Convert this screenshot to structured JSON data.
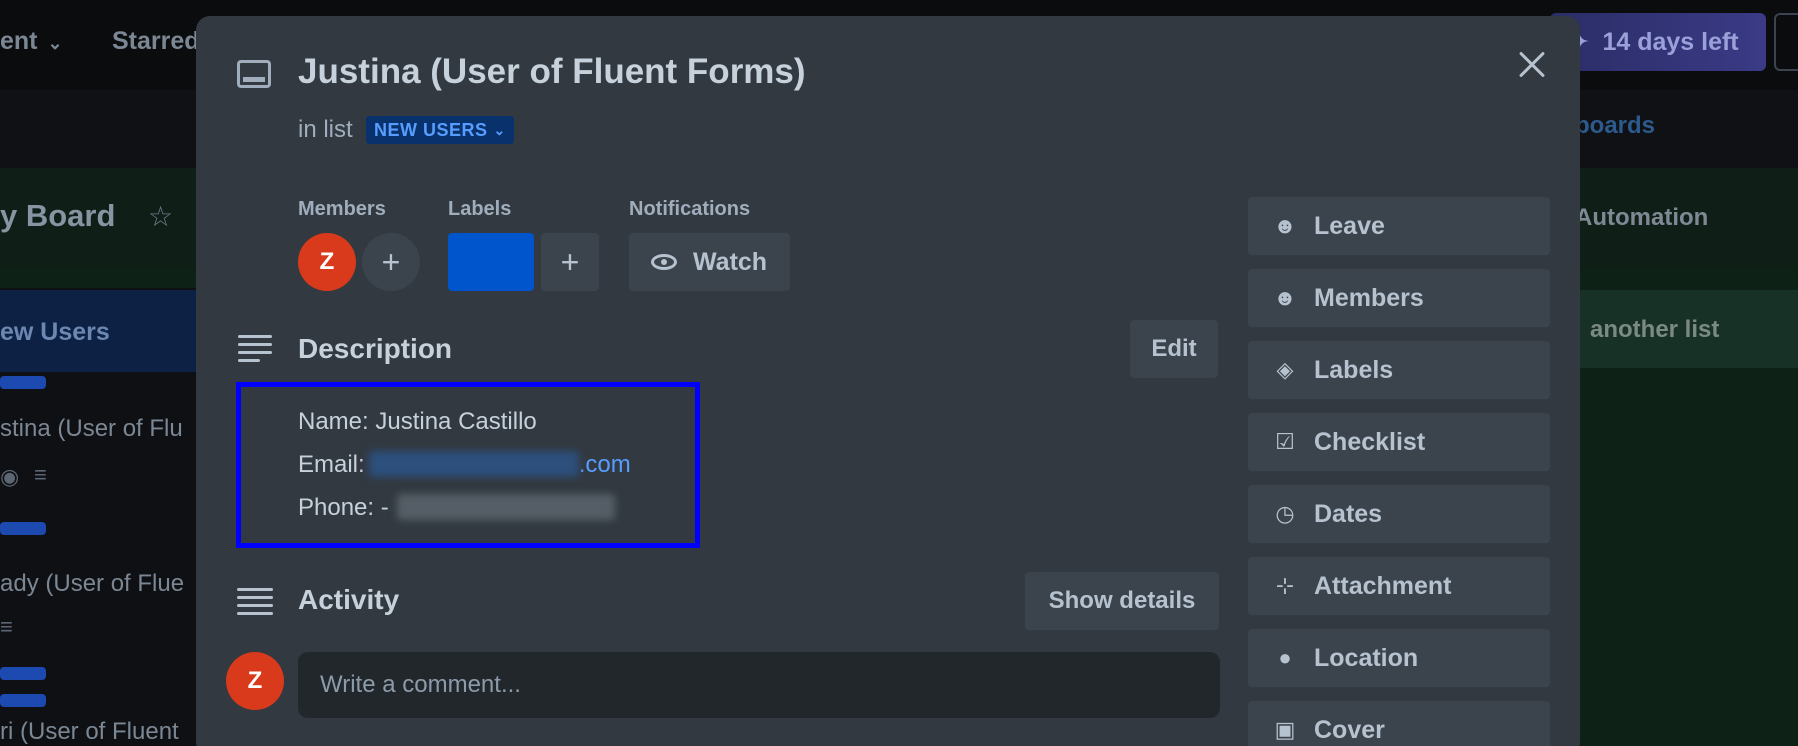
{
  "background": {
    "topbar": {
      "workspace": "ent",
      "starred": "Starred",
      "trial": "14 days left"
    },
    "subbar": {
      "public_boards": "c boards"
    },
    "board": {
      "title": "y Board",
      "automation": "Automation"
    },
    "list": {
      "title": "ew Users",
      "cards": [
        {
          "title": "stina (User of Flu"
        },
        {
          "title": "ady (User of Flue"
        },
        {
          "title": "ri (User of Fluent"
        }
      ]
    },
    "add_list": "another list"
  },
  "modal": {
    "title": "Justina (User of Fluent Forms)",
    "in_list_prefix": "in list",
    "list_name": "NEW USERS",
    "members": {
      "label": "Members",
      "avatar_initial": "Z"
    },
    "labels": {
      "label": "Labels",
      "chip_color": "#0055cc"
    },
    "notifications": {
      "label": "Notifications",
      "watch": "Watch"
    },
    "description": {
      "title": "Description",
      "edit": "Edit",
      "name_line": "Name: Justina Castillo",
      "email_prefix": "Email:",
      "email_suffix": ".com",
      "phone_prefix": "Phone: -"
    },
    "activity": {
      "title": "Activity",
      "show_details": "Show details",
      "avatar_initial": "Z",
      "comment_placeholder": "Write a comment..."
    },
    "sidebar": [
      {
        "label": "Leave",
        "icon": "user-minus-icon"
      },
      {
        "label": "Members",
        "icon": "user-icon"
      },
      {
        "label": "Labels",
        "icon": "tag-icon"
      },
      {
        "label": "Checklist",
        "icon": "checkbox-icon"
      },
      {
        "label": "Dates",
        "icon": "clock-icon"
      },
      {
        "label": "Attachment",
        "icon": "paperclip-icon"
      },
      {
        "label": "Location",
        "icon": "location-pin-icon"
      },
      {
        "label": "Cover",
        "icon": "cover-icon"
      }
    ]
  },
  "colors": {
    "accent_link": "#579dff",
    "avatar": "#d83a1b",
    "highlight_box": "#0000ff"
  }
}
